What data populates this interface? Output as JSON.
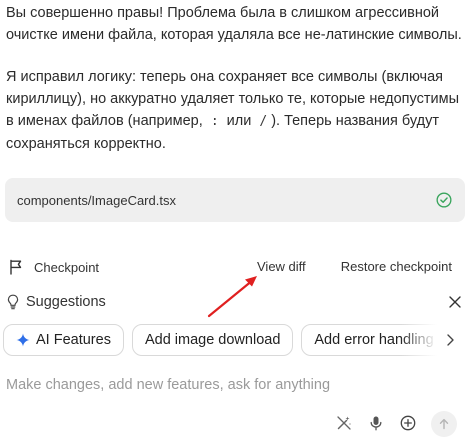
{
  "message": {
    "paragraph1": "Вы совершенно правы! Проблема была в слишком агрессивной очистке имени файла, которая удаляла все не-латинские символы.",
    "paragraph2_part1": "Я исправил логику: теперь она сохраняет все символы (включая кириллицу), но аккуратно удаляет только те, которые недопустимы в именах файлов (например, ",
    "code1": ":",
    "paragraph2_or": " или ",
    "code2": "/",
    "paragraph2_part2": "). Теперь названия будут сохраняться корректно."
  },
  "file_card": {
    "name": "components/ImageCard.tsx",
    "status_icon": "check-circle-icon",
    "status_color": "#3aa55d"
  },
  "checkpoint": {
    "label": "Checkpoint",
    "view_diff": "View diff",
    "restore": "Restore checkpoint"
  },
  "annotation": {
    "arrow_color": "#e02020"
  },
  "suggestions": {
    "title": "Suggestions",
    "accent_color": "#2f6fe8",
    "chips": [
      {
        "label": "AI Features",
        "icon": "sparkle-icon"
      },
      {
        "label": "Add image download"
      },
      {
        "label": "Add error handling"
      }
    ]
  },
  "composer": {
    "placeholder": "Make changes, add new features, ask for anything"
  }
}
